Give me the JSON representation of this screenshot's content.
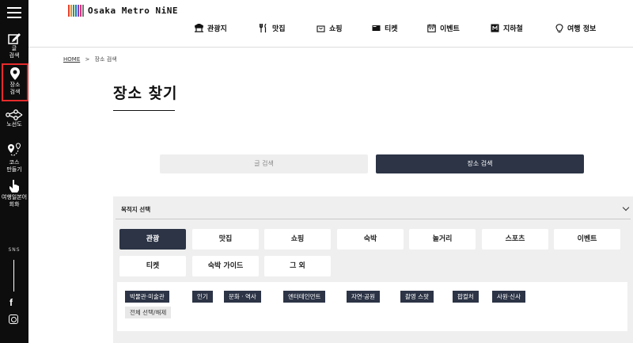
{
  "sidebar": {
    "items": [
      {
        "label1": "글",
        "label2": "검색"
      },
      {
        "label1": "장소",
        "label2": "검색"
      },
      {
        "label1": "노선도",
        "label2": ""
      },
      {
        "label1": "코스",
        "label2": "만들기"
      },
      {
        "label1": "여행일본어",
        "label2": "회화"
      }
    ],
    "sns_label": "SNS"
  },
  "header": {
    "logo_text": "Osaka Metro NiNE",
    "nav": [
      "관광지",
      "맛집",
      "쇼핑",
      "티켓",
      "이벤트",
      "지하철",
      "여행 정보"
    ]
  },
  "breadcrumb": {
    "home": "HOME",
    "separator": ">",
    "current": "장소 검색"
  },
  "page_title": "장소 찾기",
  "search_tabs": {
    "text_search": "글 검색",
    "place_search": "장소 검색"
  },
  "panel": {
    "heading": "목적지 선택",
    "categories_row1": [
      "관광",
      "맛집",
      "쇼핑",
      "숙박",
      "놀거리",
      "스포츠",
      "이벤트"
    ],
    "categories_row2": [
      "티켓",
      "숙박 가이드",
      "그 외"
    ],
    "tags": [
      "박물관·미술관",
      "인기",
      "문화 · 역사",
      "엔터테인먼트",
      "자연·공원",
      "촬영 스팟",
      "팝컬처",
      "사원·신사"
    ],
    "select_all": "전체 선택/해제"
  },
  "colors": {
    "dark_navy": "#2c3446",
    "sidebar_bg": "#0d0d0d",
    "active_outline": "#e52b2b"
  }
}
